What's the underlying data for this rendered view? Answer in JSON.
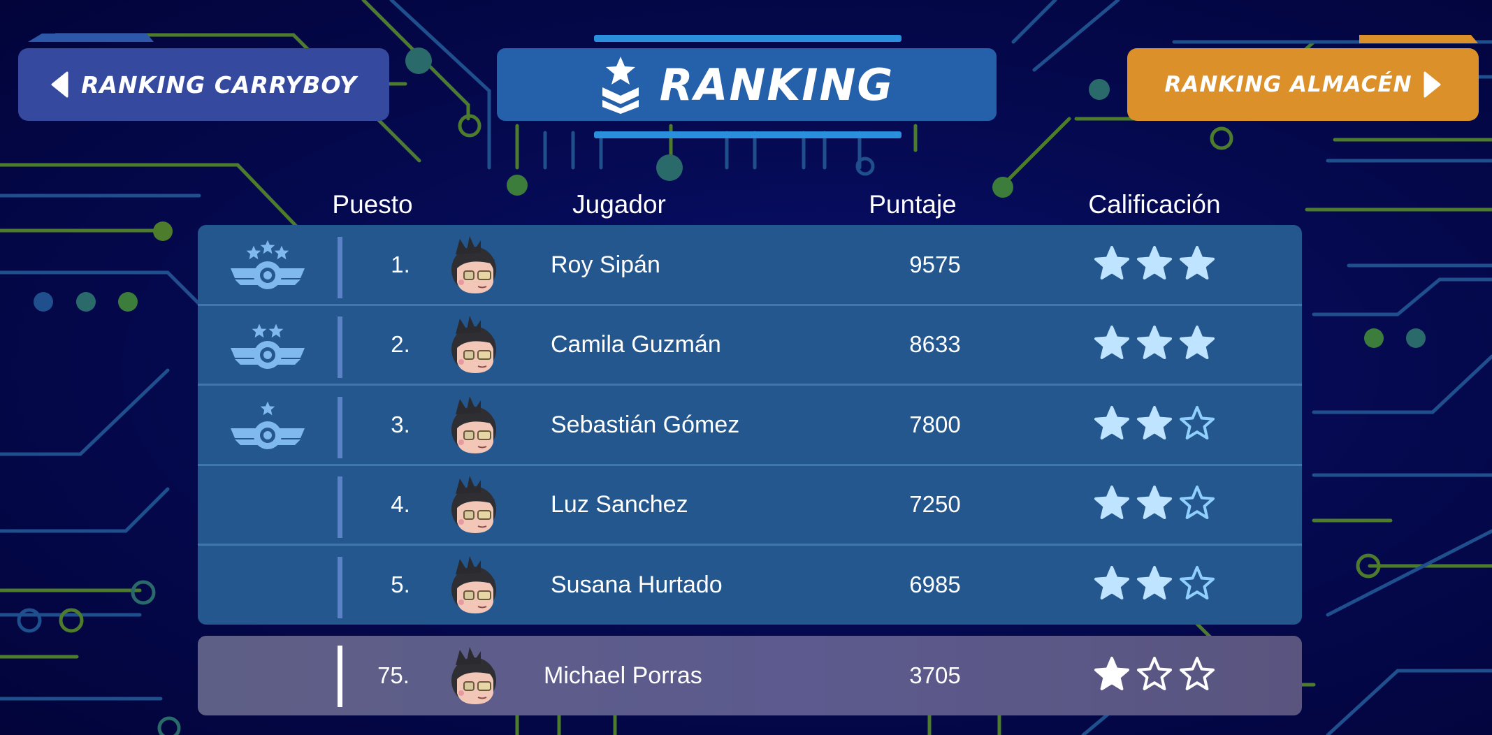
{
  "header": {
    "left_button": "RANKING CARRYBOY",
    "title": "RANKING",
    "right_button": "RANKING ALMACÉN"
  },
  "columns": {
    "position": "Puesto",
    "player": "Jugador",
    "score": "Puntaje",
    "rating": "Calificación"
  },
  "rows": [
    {
      "position": "1.",
      "name": "Roy Sipán",
      "score": "9575",
      "stars": 3,
      "medal": 3
    },
    {
      "position": "2.",
      "name": "Camila Guzmán",
      "score": "8633",
      "stars": 3,
      "medal": 2
    },
    {
      "position": "3.",
      "name": "Sebastián Gómez",
      "score": "7800",
      "stars": 2,
      "medal": 1
    },
    {
      "position": "4.",
      "name": "Luz Sanchez",
      "score": "7250",
      "stars": 2,
      "medal": 0
    },
    {
      "position": "5.",
      "name": "Susana Hurtado",
      "score": "6985",
      "stars": 2,
      "medal": 0
    }
  ],
  "current_player": {
    "position": "75.",
    "name": "Michael Porras",
    "score": "3705",
    "stars": 1
  },
  "colors": {
    "left_button": "#354a9e",
    "title_banner": "#2560aa",
    "right_button": "#dc902a",
    "table": "#25578f",
    "current_row": "#5c5a8e",
    "star_fill": "#bfe4ff",
    "circuit_green": "#5a8a2a",
    "circuit_blue": "#1e4f8f"
  },
  "icons": {
    "left_arrow": "triangle-left-icon",
    "right_arrow": "triangle-right-icon",
    "title": "rank-chevron-star-icon",
    "medal": "winged-medal-icon",
    "star": "star-icon"
  }
}
